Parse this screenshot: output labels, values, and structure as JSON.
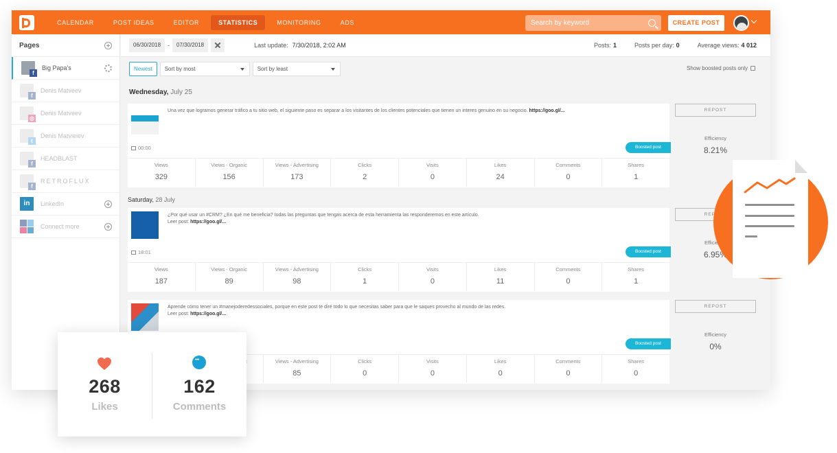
{
  "nav": {
    "items": [
      "CALENDAR",
      "POST IDEAS",
      "EDITOR",
      "STATISTICS",
      "MONITORING",
      "ADS"
    ],
    "active": "STATISTICS",
    "search_placeholder": "Search by keyword",
    "create_post": "CREATE POST"
  },
  "sidebar": {
    "title": "Pages",
    "items": [
      {
        "label": "Big Papa's",
        "network": "f"
      },
      {
        "label": "Denis Matveev",
        "network": "f"
      },
      {
        "label": "Denis Matveev",
        "network": "ig"
      },
      {
        "label": "Denis Matvieiev",
        "network": "tw"
      },
      {
        "label": "HEADBLAST",
        "network": "f"
      },
      {
        "label": "RETROFLUX",
        "network": "f"
      },
      {
        "label": "LinkedIn",
        "network": "in"
      },
      {
        "label": "Connect more",
        "network": "multi"
      }
    ]
  },
  "filters": {
    "date_from": "06/30/2018",
    "date_to": "07/30/2018",
    "separator": "-",
    "last_update_label": "Last update:",
    "last_update_value": "7/30/2018, 2:02 AM",
    "posts_label": "Posts:",
    "posts_value": "1",
    "ppd_label": "Posts per day:",
    "ppd_value": "0",
    "avg_label": "Average views:",
    "avg_value": "4 012"
  },
  "sort": {
    "newest": "Newest",
    "sort_most": "Sort by most",
    "sort_least": "Sort by least",
    "show_boosted": "Show boosted posts only"
  },
  "stat_labels": [
    "Views",
    "Views - Organic",
    "Views - Advertising",
    "Clicks",
    "Visits",
    "Likes",
    "Comments",
    "Shares"
  ],
  "days": [
    {
      "weekday": "Wednesday,",
      "date": "July 25"
    },
    {
      "weekday": "Saturday,",
      "date": "28 July"
    }
  ],
  "posts": [
    {
      "text": "Una vez que logramos generar tráfico a tu sitio web, el siguiente paso es separar a los visitantes de los clientes potenciales que tienen un interes genuino en su negocio.",
      "link": "https://goo.gl/...",
      "time": "00:00",
      "boost": "Boosted post",
      "stats": [
        "329",
        "156",
        "173",
        "2",
        "0",
        "24",
        "0",
        "1"
      ],
      "repost": "REPOST",
      "eff_label": "Efficiency",
      "eff_value": "8.21%"
    },
    {
      "text": "¿Por qué usar un #CRM? ¿En qué me beneficia? todas las preguntas que tengas acerca de esta herramienta las responderemos en este artículo.",
      "text2": "Leer post:",
      "link": "https://goo.gl/...",
      "time": "18:01",
      "boost": "Boosted post",
      "stats": [
        "187",
        "89",
        "98",
        "1",
        "0",
        "11",
        "0",
        "1"
      ],
      "repost": "REPOST",
      "eff_label": "Efficiency",
      "eff_value": "6.95%"
    },
    {
      "text": "Aprende cómo tener un #manejoderedessociales, porque en este post te diré todo lo que necesitas saber para que le saques provecho al mundo de las redes.",
      "text2": "Leer post:",
      "link": "https://goo.gl/...",
      "boost": "Boosted post",
      "stats": [
        "",
        "",
        "85",
        "0",
        "0",
        "0",
        "0",
        "0"
      ],
      "repost": "REPOST",
      "eff_label": "Efficiency",
      "eff_value": "0%"
    }
  ],
  "overlay": {
    "likes_value": "268",
    "likes_label": "Likes",
    "comments_value": "162",
    "comments_label": "Comments"
  },
  "colors": {
    "brand": "#f7701f",
    "accent": "#2aa7d8",
    "boost": "#1cb6d6"
  }
}
